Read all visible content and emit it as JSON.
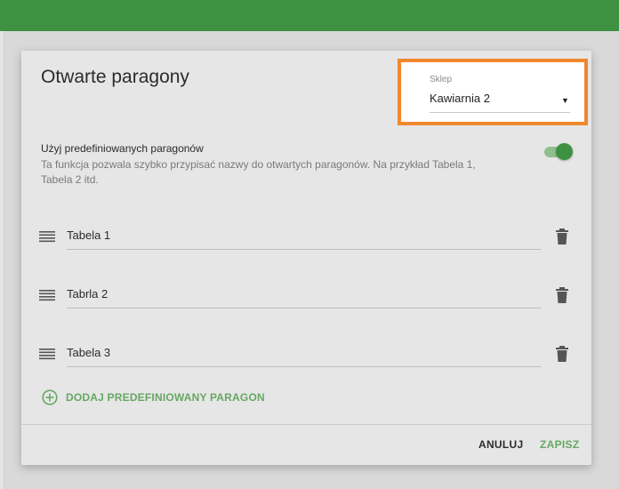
{
  "dialog": {
    "title": "Otwarte paragony",
    "store": {
      "label": "Sklep",
      "value": "Kawiarnia 2"
    },
    "predefined": {
      "title": "Użyj predefiniowanych paragonów",
      "description": "Ta funkcja pozwala szybko przypisać nazwy do otwartych paragonów. Na przykład Tabela 1, Tabela 2 itd.",
      "enabled": true
    },
    "receipts": [
      {
        "name": "Tabela 1"
      },
      {
        "name": "Tabrla 2"
      },
      {
        "name": "Tabela 3"
      }
    ],
    "add_label": "DODAJ PREDEFINIOWANY PARAGON",
    "cancel_label": "ANULUJ",
    "save_label": "ZAPISZ"
  },
  "colors": {
    "topbar": "#3d9141",
    "accent": "#66a863",
    "highlight_border": "#f0872d"
  },
  "icons": {
    "drag": "drag-handle-icon",
    "delete": "trash-icon",
    "add": "add-circle-icon",
    "dropdown": "dropdown-arrow-icon"
  }
}
